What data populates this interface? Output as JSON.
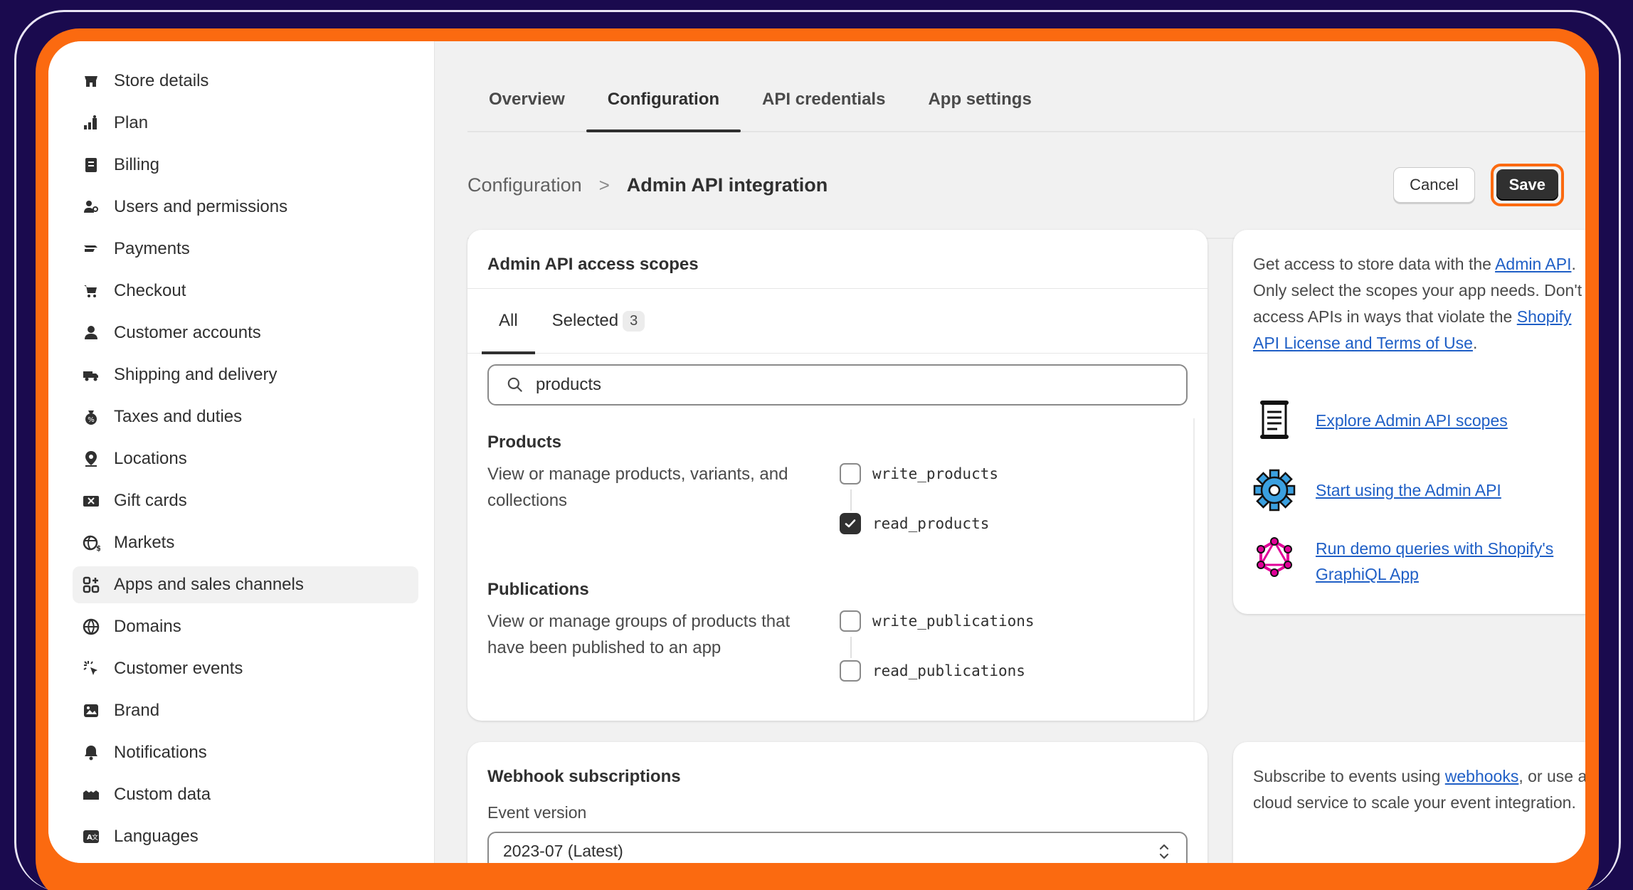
{
  "colors": {
    "frame_orange": "#fb6a10",
    "background_navy": "#1a0a4e",
    "link_blue": "#1f5fc6",
    "button_dark": "#303030"
  },
  "sidebar": {
    "items": [
      {
        "label": "Store details",
        "icon": "store-icon"
      },
      {
        "label": "Plan",
        "icon": "plan-icon"
      },
      {
        "label": "Billing",
        "icon": "billing-icon"
      },
      {
        "label": "Users and permissions",
        "icon": "users-icon"
      },
      {
        "label": "Payments",
        "icon": "payments-icon"
      },
      {
        "label": "Checkout",
        "icon": "cart-icon"
      },
      {
        "label": "Customer accounts",
        "icon": "person-icon"
      },
      {
        "label": "Shipping and delivery",
        "icon": "truck-icon"
      },
      {
        "label": "Taxes and duties",
        "icon": "money-bag-icon"
      },
      {
        "label": "Locations",
        "icon": "location-pin-icon"
      },
      {
        "label": "Gift cards",
        "icon": "gift-card-icon"
      },
      {
        "label": "Markets",
        "icon": "globe-currency-icon"
      },
      {
        "label": "Apps and sales channels",
        "icon": "apps-icon",
        "active": true
      },
      {
        "label": "Domains",
        "icon": "globe-icon"
      },
      {
        "label": "Customer events",
        "icon": "cursor-click-icon"
      },
      {
        "label": "Brand",
        "icon": "brand-icon"
      },
      {
        "label": "Notifications",
        "icon": "bell-icon"
      },
      {
        "label": "Custom data",
        "icon": "custom-data-icon"
      },
      {
        "label": "Languages",
        "icon": "language-icon"
      }
    ]
  },
  "tabs": [
    {
      "label": "Overview"
    },
    {
      "label": "Configuration",
      "active": true
    },
    {
      "label": "API credentials"
    },
    {
      "label": "App settings"
    }
  ],
  "breadcrumb": {
    "parent": "Configuration",
    "separator": ">",
    "current": "Admin API integration"
  },
  "actions": {
    "cancel_label": "Cancel",
    "save_label": "Save"
  },
  "scopes_card": {
    "title": "Admin API access scopes",
    "tab_all": "All",
    "tab_selected": "Selected",
    "selected_count": "3",
    "search_value": "products",
    "groups": [
      {
        "title": "Products",
        "description": "View or manage products, variants, and collections",
        "permissions": [
          {
            "label": "write_products",
            "checked": false
          },
          {
            "label": "read_products",
            "checked": true
          }
        ]
      },
      {
        "title": "Publications",
        "description": "View or manage groups of products that have been published to an app",
        "permissions": [
          {
            "label": "write_publications",
            "checked": false
          },
          {
            "label": "read_publications",
            "checked": false
          }
        ]
      }
    ]
  },
  "info_card": {
    "text_1": "Get access to store data with the ",
    "link_admin_api": "Admin API",
    "text_2": ". Only select the scopes your app needs. Don't access APIs in ways that violate the ",
    "link_license": "Shopify API License and Terms of Use",
    "text_3": ".",
    "resources": [
      {
        "label": "Explore Admin API scopes",
        "icon": "document-icon"
      },
      {
        "label": "Start using the Admin API",
        "icon": "gear-icon"
      },
      {
        "label": "Run demo queries with Shopify's GraphiQL App",
        "icon": "graphql-icon"
      }
    ]
  },
  "webhook_card": {
    "title": "Webhook subscriptions",
    "event_version_label": "Event version",
    "event_version_value": "2023-07 (Latest)"
  },
  "webhook_info": {
    "text_1": "Subscribe to events using ",
    "link_webhooks": "webhooks",
    "text_2": ", or use a cloud service to scale your event integration."
  }
}
